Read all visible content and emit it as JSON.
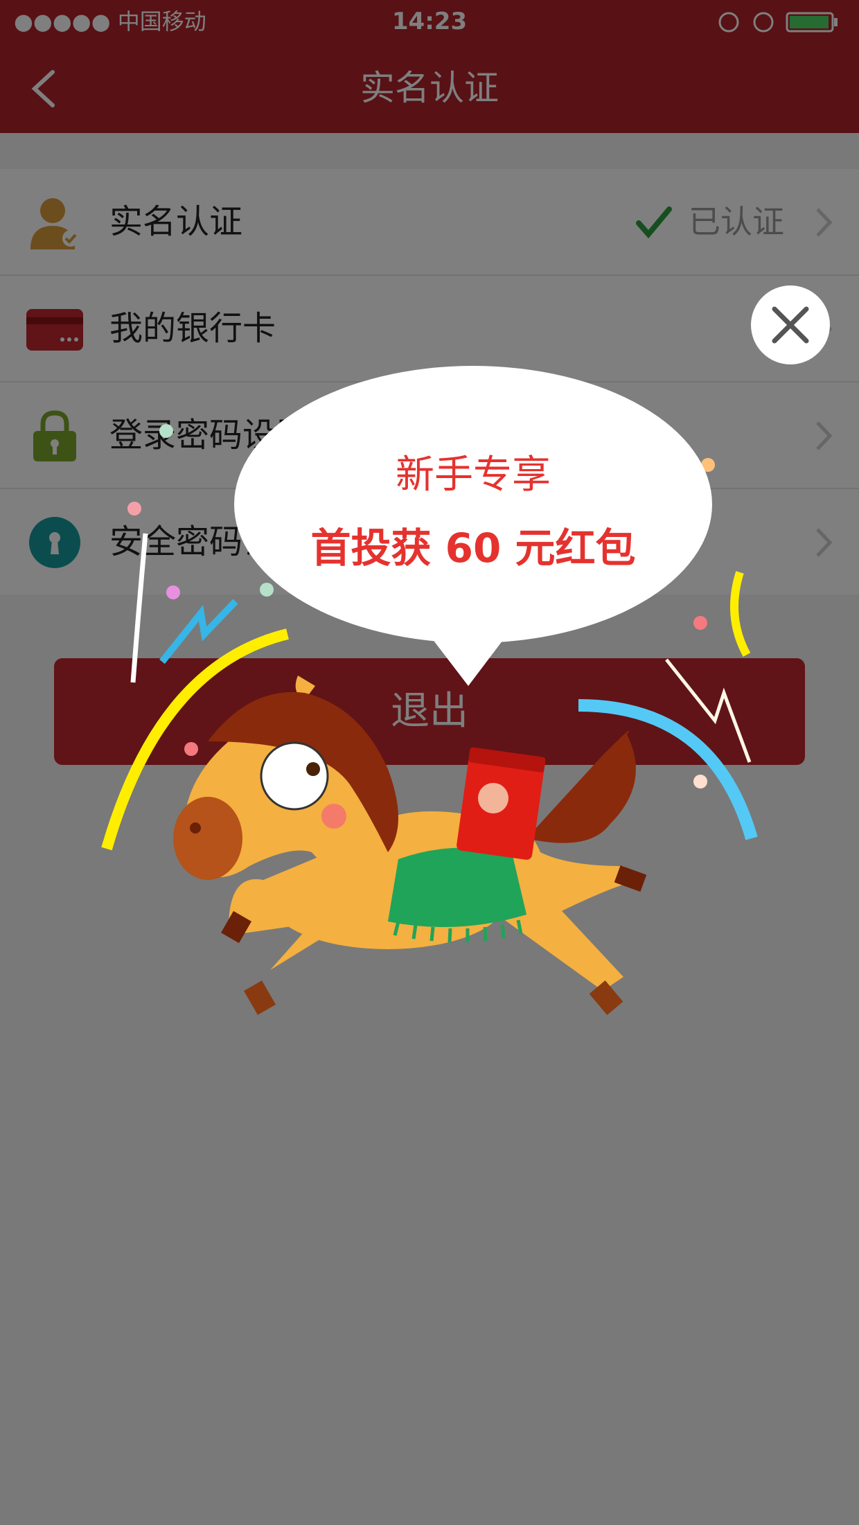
{
  "status_bar": {
    "carrier": "●●●●● 中国移动",
    "time": "14:23"
  },
  "nav": {
    "title": "实名认证",
    "back_icon": "chevron-left-icon"
  },
  "list": {
    "items": [
      {
        "label": "实名认证",
        "icon": "user-verified-icon",
        "status": "已认证"
      },
      {
        "label": "我的银行卡",
        "icon": "bank-card-icon"
      },
      {
        "label": "登录密码设置",
        "icon": "lock-icon"
      },
      {
        "label": "安全密码设置",
        "icon": "keyhole-icon"
      }
    ]
  },
  "logout_label": "退出",
  "popup": {
    "title": "新手专享",
    "subtitle": "首投获 60 元红包",
    "close_icon": "close-icon",
    "mascot": "horse-with-red-envelope-illustration"
  },
  "colors": {
    "brand_red": "#b0232a",
    "promo_red": "#e5322e",
    "check_green": "#2e9c3f"
  }
}
